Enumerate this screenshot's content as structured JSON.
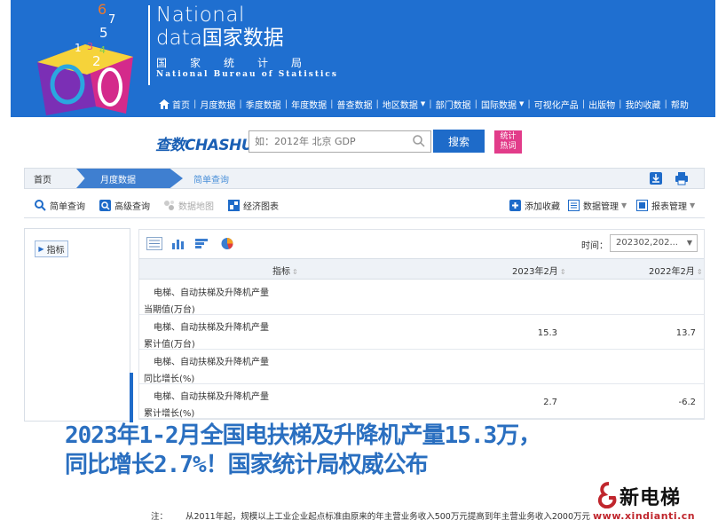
{
  "header": {
    "brand_en1": "National",
    "brand_en2": "data国家数据",
    "brand_cn": "国家统计局",
    "brand_en3": "National Bureau of Statistics",
    "nav": [
      {
        "label": "首页"
      },
      {
        "label": "月度数据"
      },
      {
        "label": "季度数据"
      },
      {
        "label": "年度数据"
      },
      {
        "label": "普查数据"
      },
      {
        "label": "地区数据"
      },
      {
        "label": "部门数据"
      },
      {
        "label": "国际数据"
      },
      {
        "label": "可视化产品"
      },
      {
        "label": "出版物"
      },
      {
        "label": "我的收藏"
      },
      {
        "label": "帮助"
      }
    ]
  },
  "search": {
    "logo_cn": "查数",
    "logo_en": "CHASHU",
    "placeholder": "如：2012年 北京 GDP",
    "button": "搜索",
    "badge_line1": "统计",
    "badge_line2": "热词"
  },
  "breadcrumb": {
    "home": "首页",
    "monthly": "月度数据",
    "simple": "简单查询"
  },
  "toolbar": {
    "simple_query": "简单查询",
    "advanced_query": "高级查询",
    "data_map": "数据地图",
    "econ_chart": "经济图表",
    "add_favorite": "添加收藏",
    "data_manage": "数据管理",
    "report_manage": "报表管理"
  },
  "left_panel": {
    "indicator": "指标"
  },
  "table": {
    "time_label": "时间：",
    "time_value": "202302,202...",
    "headers": [
      "指标",
      "2023年2月",
      "2022年2月"
    ],
    "rows": [
      {
        "name1": "电梯、自动扶梯及升降机产量",
        "name2": "当期值(万台)",
        "v2023": "",
        "v2022": ""
      },
      {
        "name1": "电梯、自动扶梯及升降机产量",
        "name2": "累计值(万台)",
        "v2023": "15.3",
        "v2022": "13.7"
      },
      {
        "name1": "电梯、自动扶梯及升降机产量",
        "name2": "同比增长(%)",
        "v2023": "",
        "v2022": ""
      },
      {
        "name1": "电梯、自动扶梯及升降机产量",
        "name2": "累计增长(%)",
        "v2023": "2.7",
        "v2022": "-6.2"
      }
    ]
  },
  "headline": {
    "line1": "2023年1-2月全国电扶梯及升降机产量15.3万，",
    "line2": "同比增长2.7%！国家统计局权威公布"
  },
  "note": {
    "label": "注：",
    "text": "从2011年起，规模以上工业企业起点标准由原来的年主营业务收入500万元提高到年主营业务收入2000万元"
  },
  "watermark": {
    "cn": "新电梯",
    "url": "www.xindianti.cn"
  },
  "colors": {
    "header_blue": "#1f6fd0",
    "accent_blue": "#1e6bc9",
    "badge_pink": "#e23c8a",
    "headline_blue": "#2a6fc0"
  }
}
